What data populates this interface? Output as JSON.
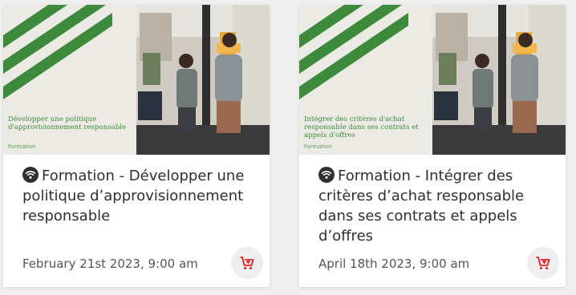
{
  "colors": {
    "accent_green": "#3d8a3d",
    "cart_red": "#e0202a",
    "title_text": "#2f2f2f",
    "meta_text": "#555555"
  },
  "cards": [
    {
      "thumbnail": {
        "title": "Développer une politique d'approvisionnement responsable",
        "tag": "Formation"
      },
      "icon": "wifi-online-icon",
      "title": "Formation - Développer une politique d’approvisionnement responsable",
      "date": "February 21st 2023, 9:00 am",
      "cart_icon": "add-to-cart-icon"
    },
    {
      "thumbnail": {
        "title": "Intégrer des critères d'achat responsable dans ses contrats et appels d'offres",
        "tag": "Formation"
      },
      "icon": "wifi-online-icon",
      "title": "Formation - Intégrer des critères d’achat responsable dans ses contrats et appels d’offres",
      "date": "April 18th 2023, 9:00 am",
      "cart_icon": "add-to-cart-icon"
    }
  ]
}
